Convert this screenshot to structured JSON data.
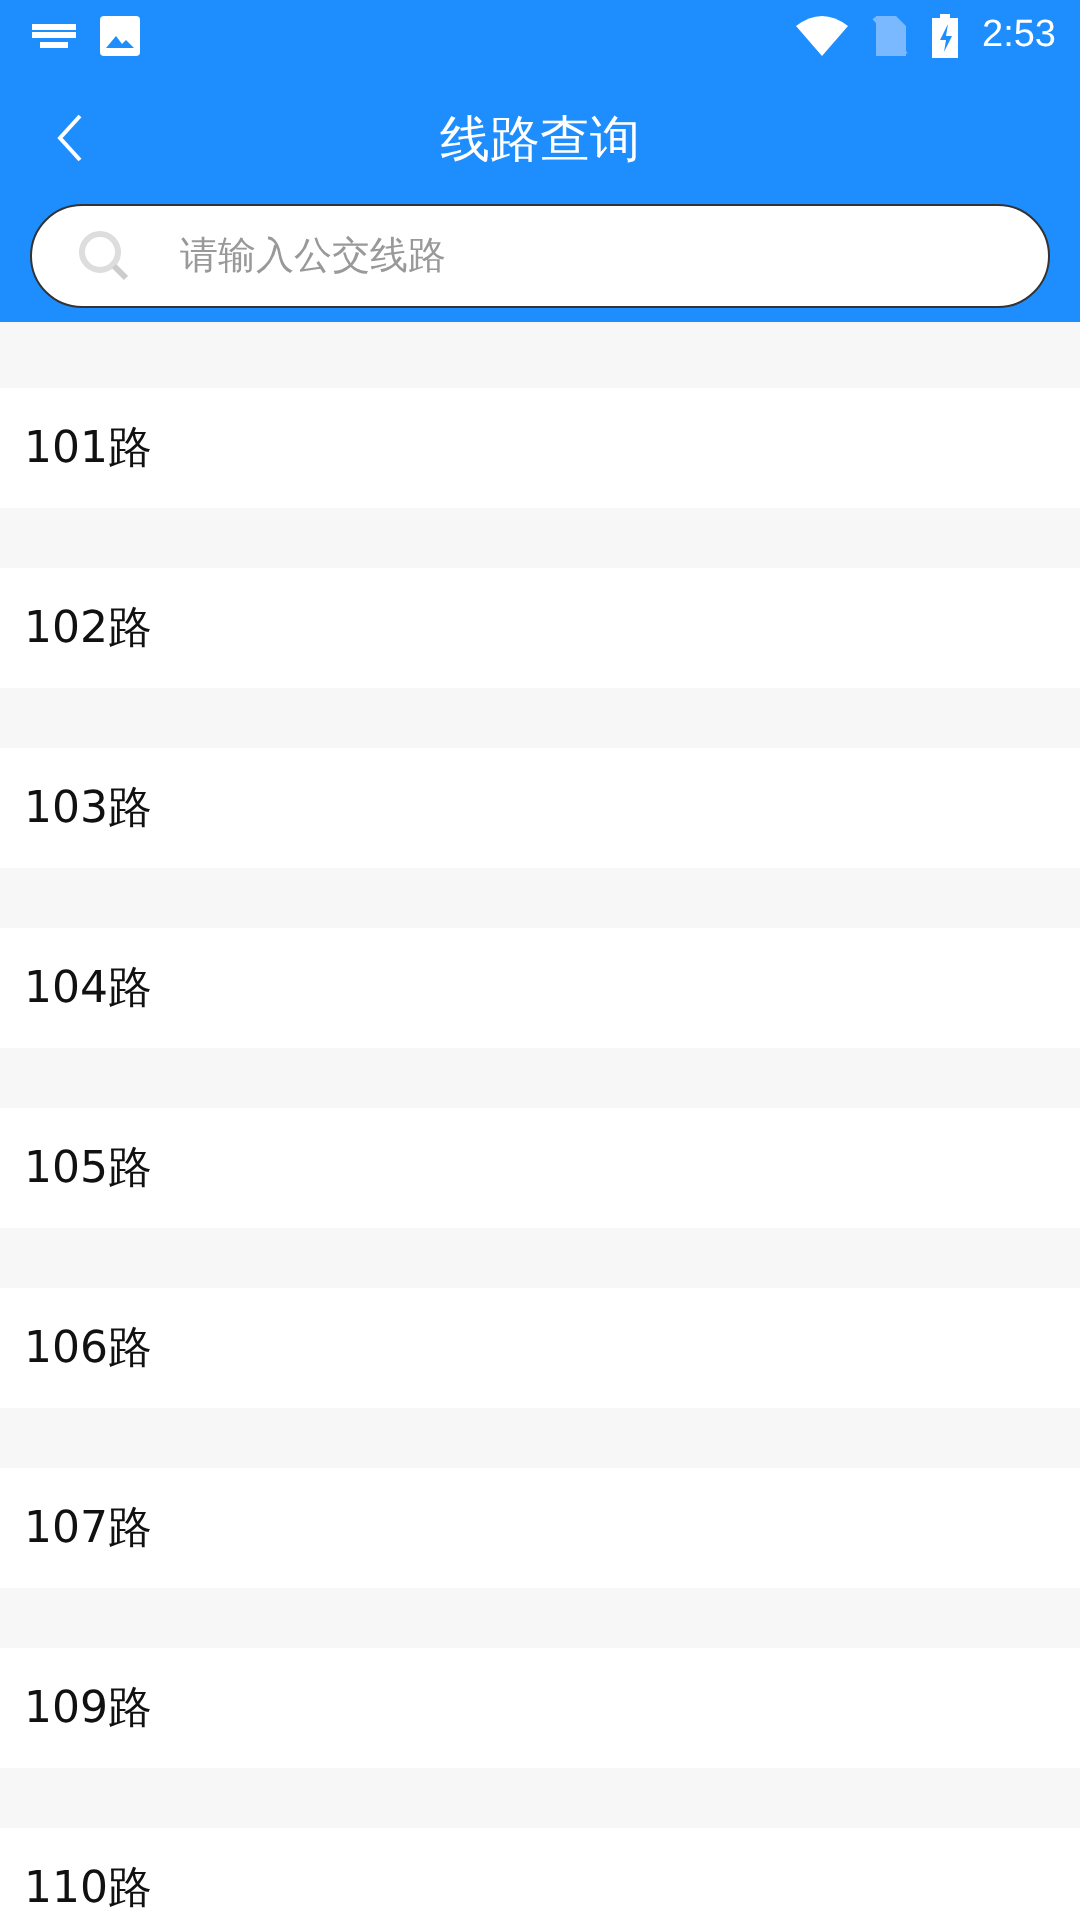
{
  "status_bar": {
    "time": "2:53"
  },
  "header": {
    "title": "线路查询"
  },
  "search": {
    "placeholder": "请输入公交线路"
  },
  "routes": [
    {
      "name": "101路"
    },
    {
      "name": "102路"
    },
    {
      "name": "103路"
    },
    {
      "name": "104路"
    },
    {
      "name": "105路"
    },
    {
      "name": "106路"
    },
    {
      "name": "107路"
    },
    {
      "name": "109路"
    },
    {
      "name": "110路"
    }
  ]
}
